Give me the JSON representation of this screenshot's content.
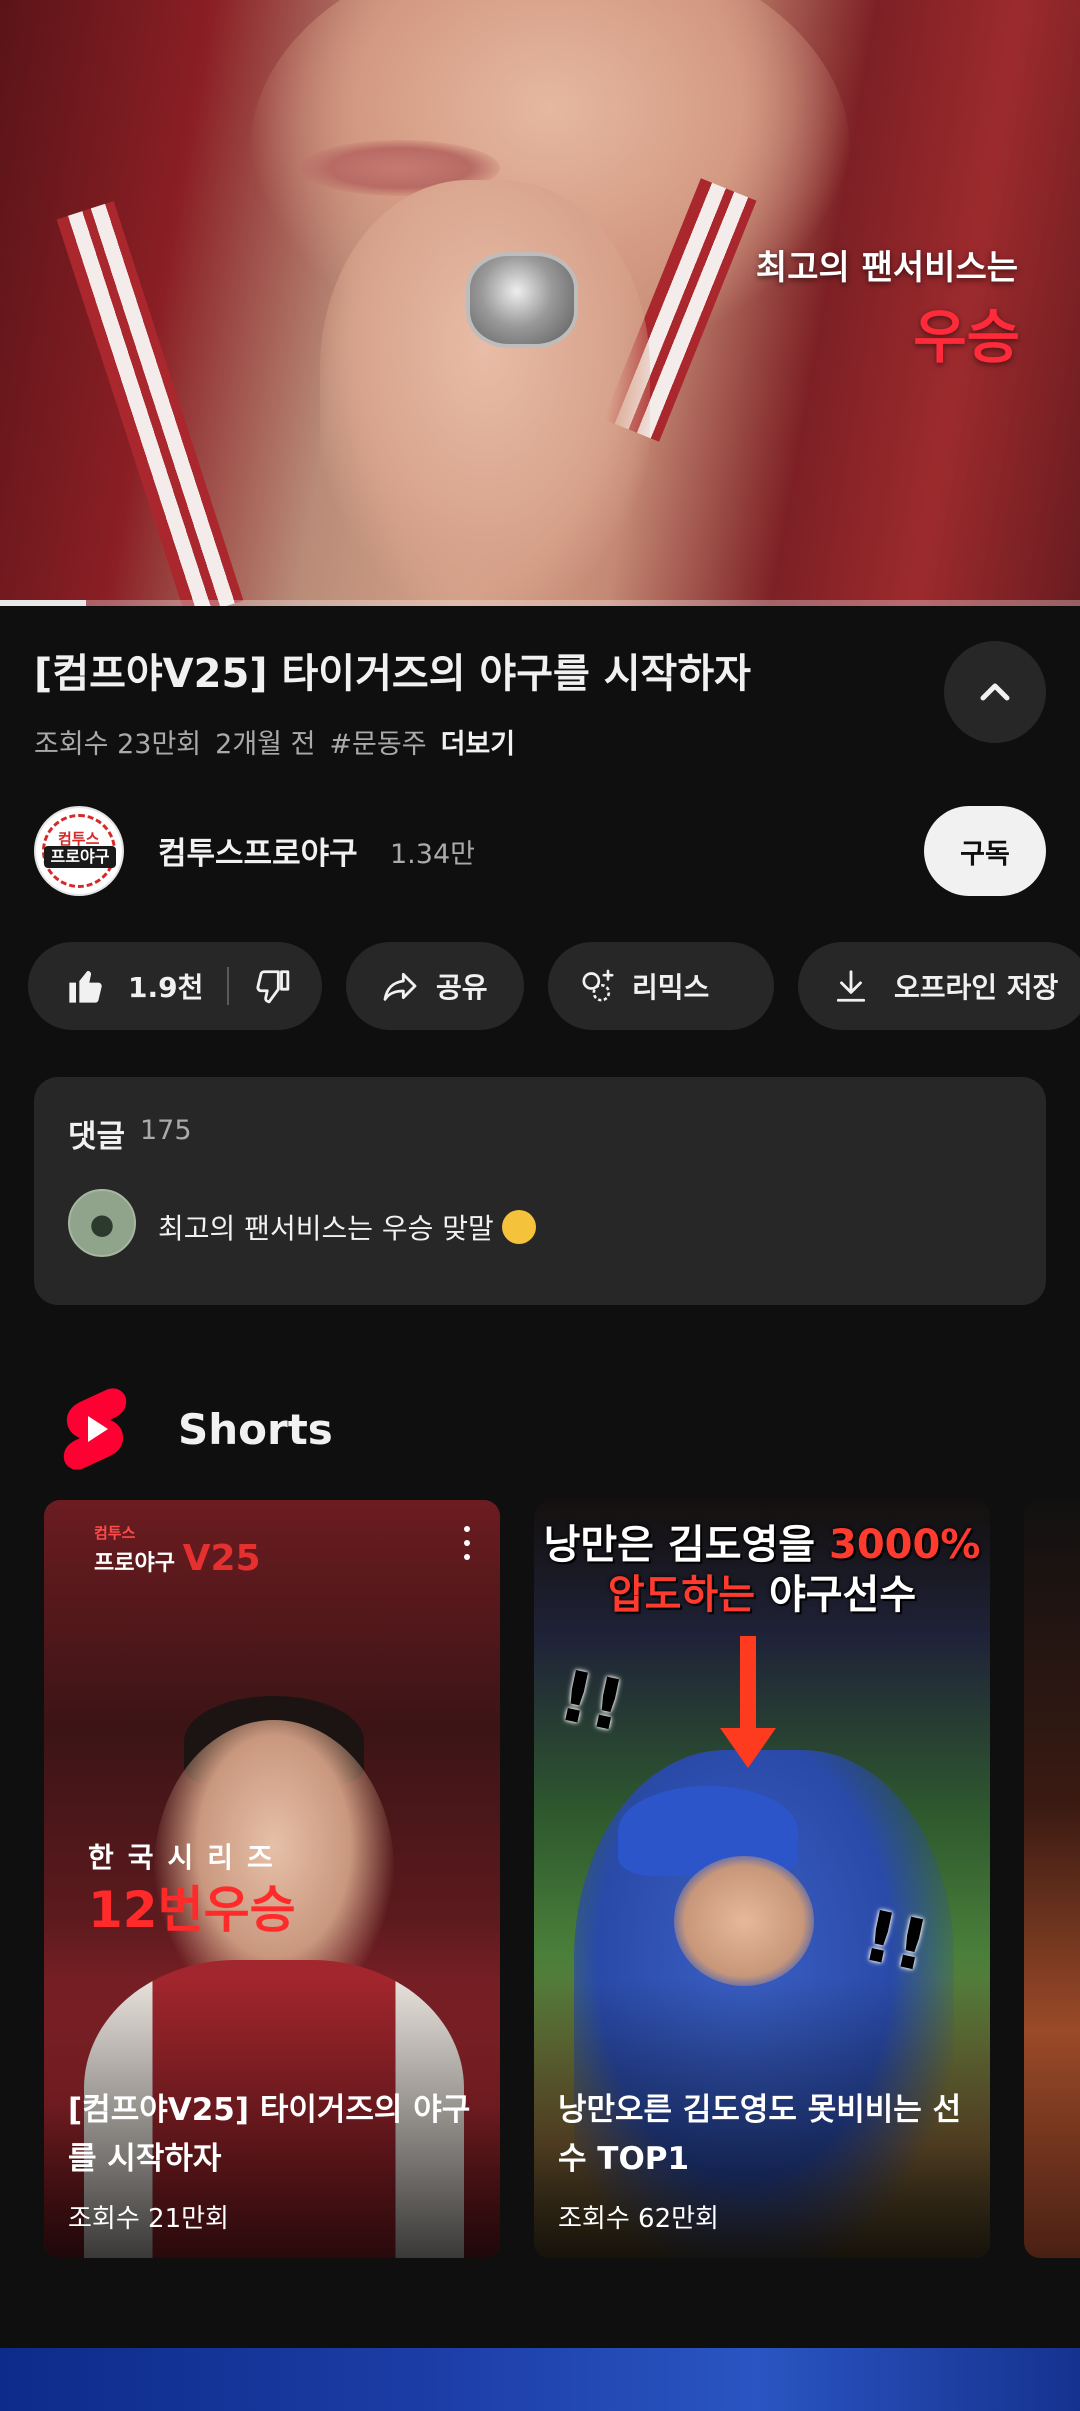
{
  "player": {
    "overlay_line1": "최고의 팬서비스는",
    "overlay_line2": "우승",
    "progress": 0.08
  },
  "video": {
    "title": "[컴프야V25] 타이거즈의 야구를 시작하자",
    "views": "조회수 23만회",
    "age": "2개월 전",
    "hashtag": "#문동주",
    "more_label": "더보기"
  },
  "channel": {
    "name": "컴투스프로야구",
    "subscribers": "1.34만",
    "avatar_top": "컴투스",
    "avatar_bottom": "프로야구",
    "subscribe_label": "구독"
  },
  "actions": {
    "like_count": "1.9천",
    "share_label": "공유",
    "remix_label": "리믹스",
    "download_label": "오프라인 저장"
  },
  "comments": {
    "header": "댓글",
    "count": "175",
    "top_comment": "최고의 팬서비스는 우승 맞말"
  },
  "shorts": {
    "section_title": "Shorts",
    "items": [
      {
        "title": "[컴프야V25] 타이거즈의 야구를 시작하자",
        "views": "조회수 21만회",
        "brand_top": "컴투스",
        "brand": "프로야구",
        "brand_v": "V25",
        "overlay1": "한국시리즈",
        "overlay2": "12번우승"
      },
      {
        "title": "낭만오른 김도영도 못비비는 선수 TOP1",
        "views": "조회수 62만회",
        "headline1_a": "낭만은 김도영을 ",
        "headline1_b": "3000%",
        "headline2_a": "압도하는",
        "headline2_b": " 야구선수"
      }
    ]
  },
  "colors": {
    "background": "#0f0f0f",
    "surface": "#272727",
    "brand_red": "#ff0033",
    "text_primary": "#f1f1f1",
    "text_secondary": "#aaaaaa"
  }
}
